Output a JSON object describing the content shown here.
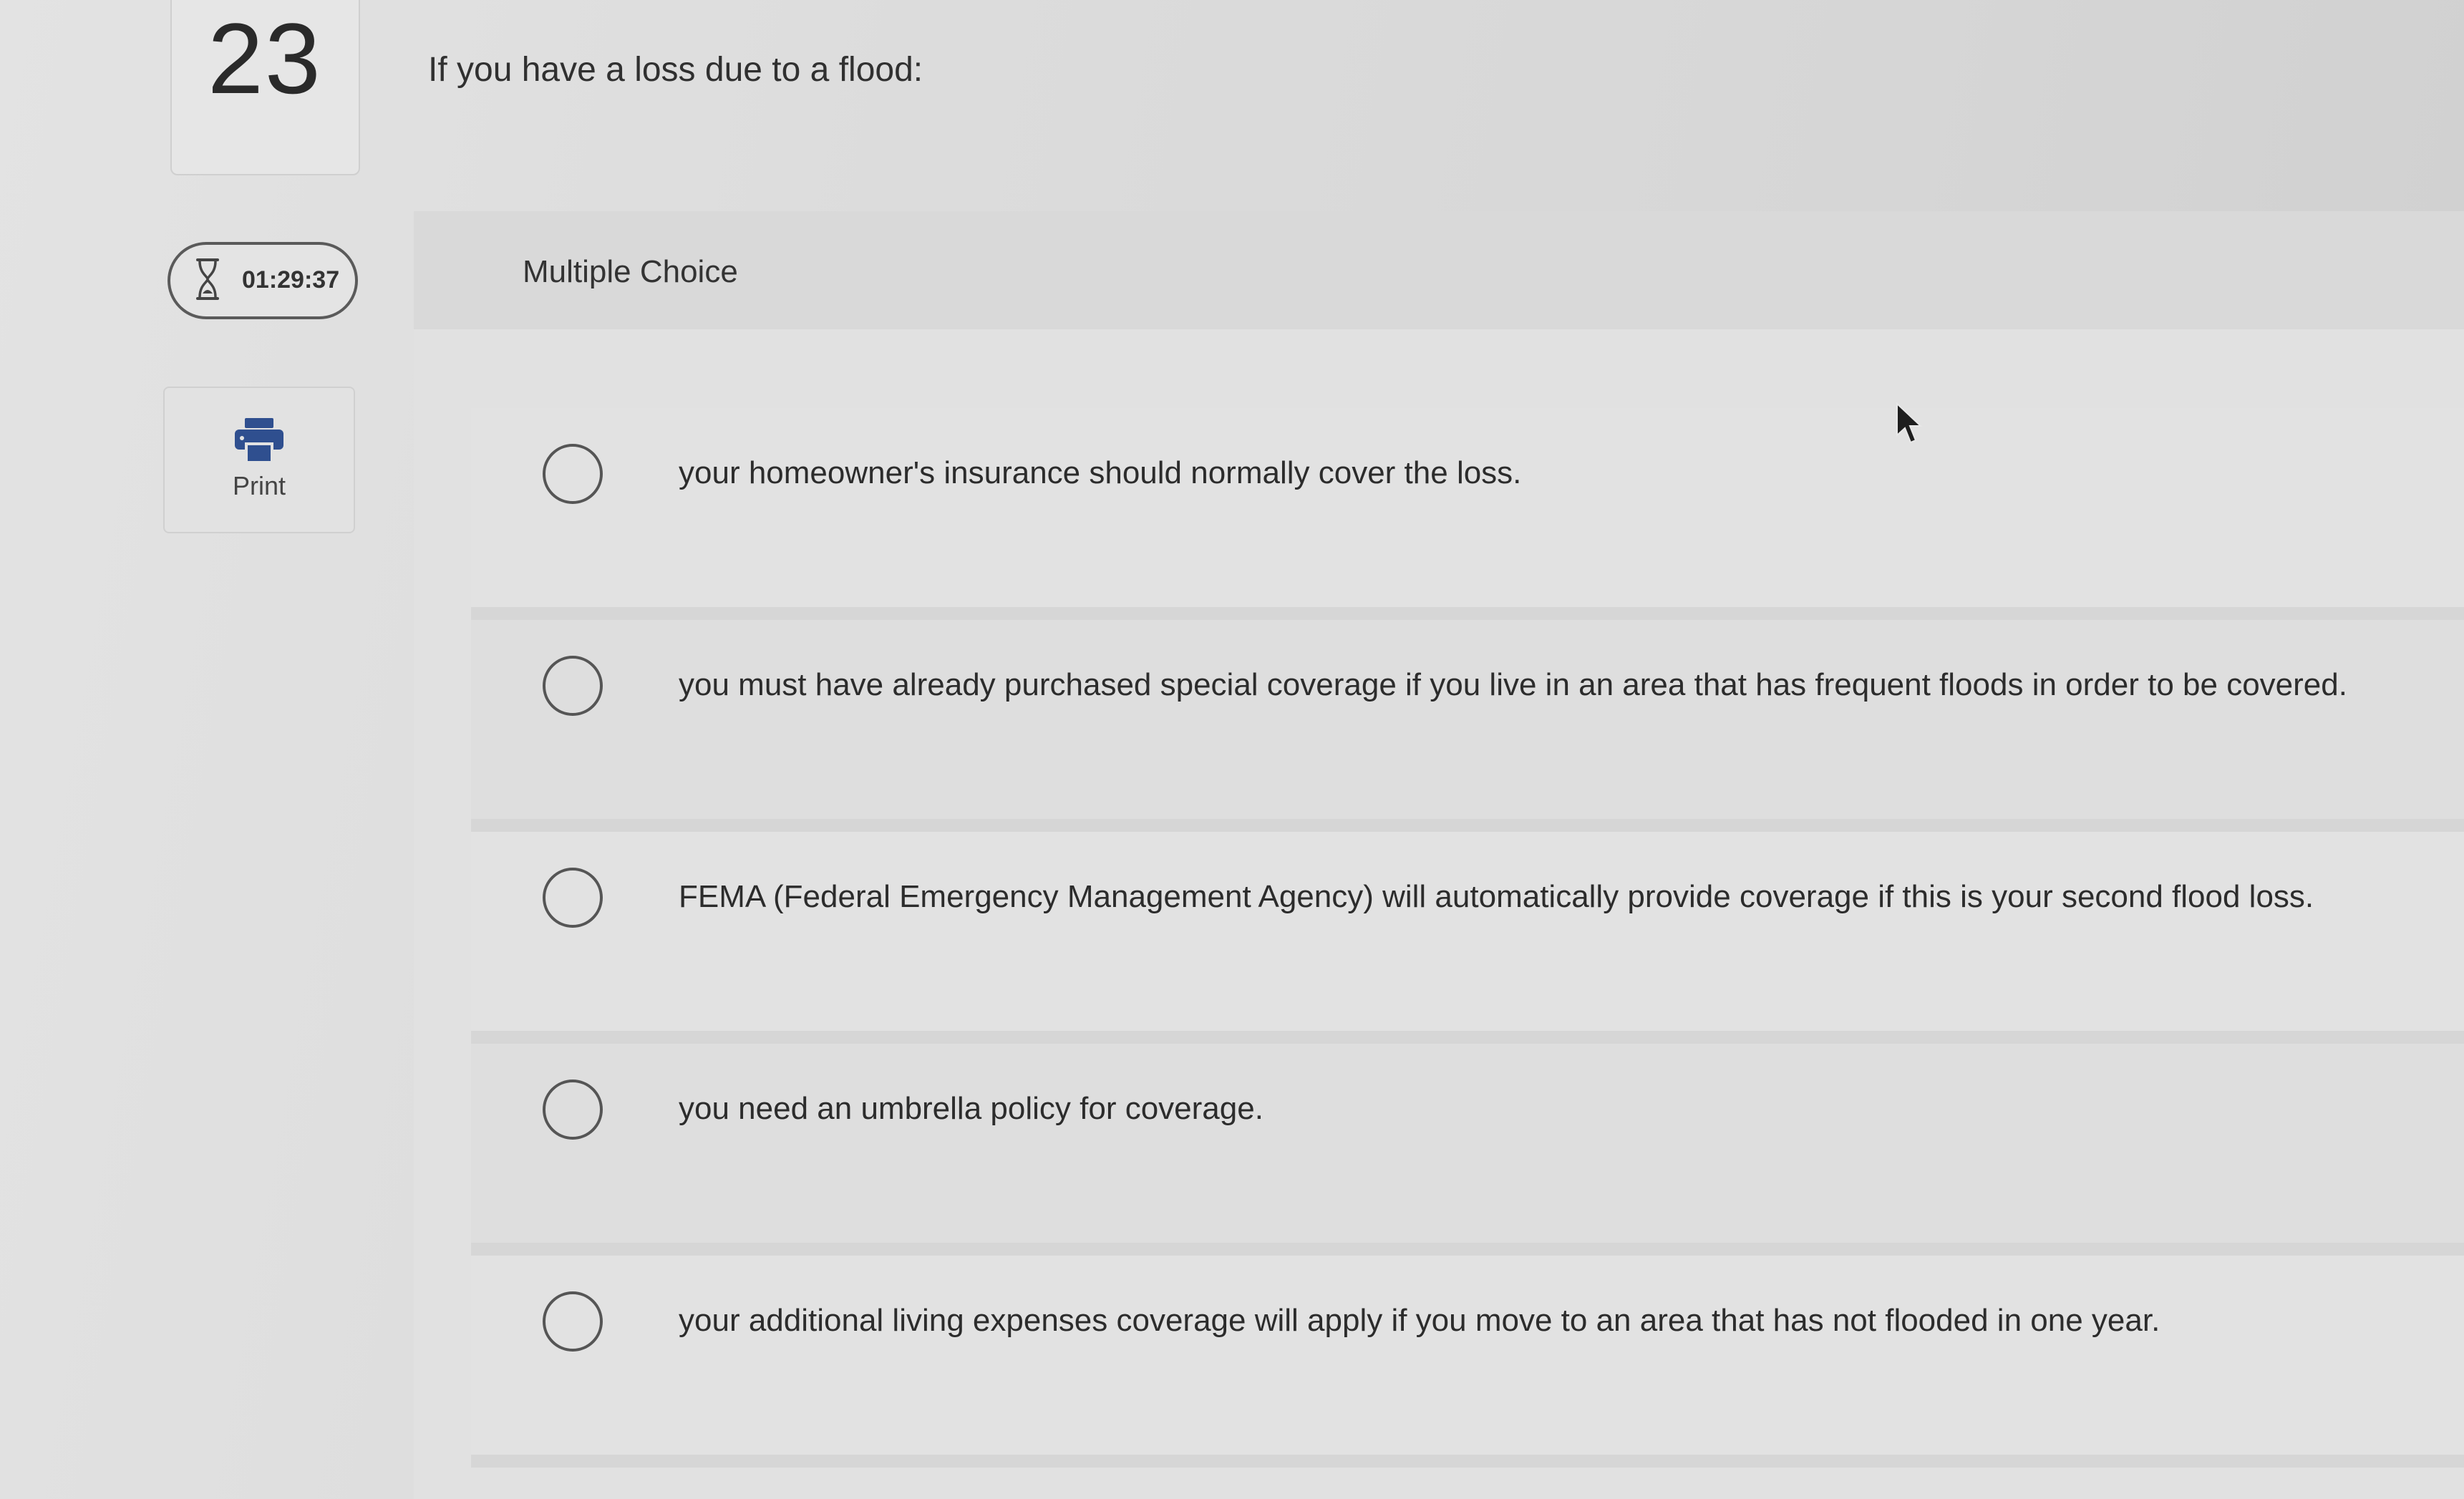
{
  "question_number": "23",
  "timer": "01:29:37",
  "print_label": "Print",
  "question_text": "If you have a loss due to a flood:",
  "question_type": "Multiple Choice",
  "options": [
    {
      "text": "your homeowner's insurance should normally cover the loss."
    },
    {
      "text": "you must have already purchased special coverage if you live in an area that has frequent floods in order to be covered."
    },
    {
      "text": "FEMA (Federal Emergency Management Agency) will automatically provide coverage if this is your second flood loss."
    },
    {
      "text": "you need an umbrella policy for coverage."
    },
    {
      "text": "your additional living expenses coverage will apply if you move to an area that has not flooded in one year."
    }
  ],
  "icons": {
    "timer": "hourglass-icon",
    "print": "printer-icon",
    "cursor": "mouse-pointer-icon"
  },
  "colors": {
    "accent": "#2f4f8f"
  }
}
